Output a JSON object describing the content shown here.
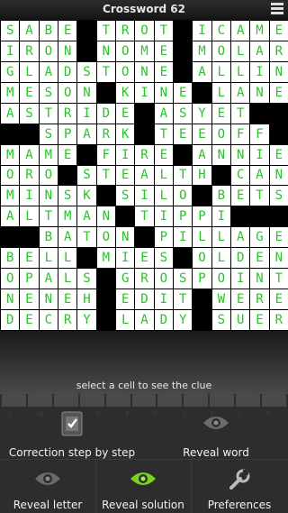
{
  "app": {
    "title": "Crossword 62"
  },
  "grid": {
    "rows": [
      "SABE#TROT#ICAME",
      "IRON#NOME#MOLAR",
      "GLADSTONE#ALLIN",
      "MESON#KINE#LANE",
      "ASTRIDE#ASYET##",
      "##SPARK#TEEOFF#",
      "MAME#FIRE#ANNIE",
      "ORO#STEALTH#CAN",
      "MINSK#SILO#BETS",
      "ALTMAN#TIPPI###",
      "##BATON#PILLAGE",
      "BELL#MIES#OLDEN",
      "OPALS#GROSPOINT",
      "NENEH#EDIT#WERE",
      "DECRY#LADY#SUER"
    ]
  },
  "status": {
    "clue_hint": "select a cell to see the clue"
  },
  "keyboard_ghost": "Q W E R T Y U I O P",
  "actions": {
    "correction": "Correction step by step",
    "reveal_word": "Reveal word",
    "reveal_letter": "Reveal letter",
    "reveal_solution": "Reveal solution",
    "preferences": "Preferences"
  },
  "colors": {
    "letter": "#27c427",
    "accent_eye": "#7ad21e"
  }
}
